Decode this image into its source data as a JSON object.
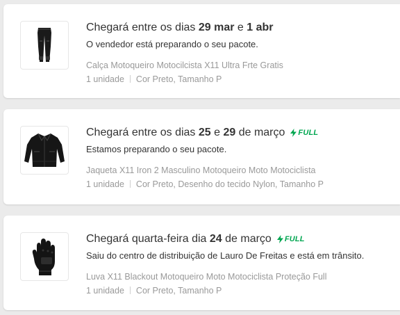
{
  "accent_color": "#00a650",
  "orders": [
    {
      "headline": {
        "prefix": "Chegará entre os dias ",
        "d1": "29 mar",
        "mid": " e ",
        "d2": "1 abr",
        "suffix": ""
      },
      "full_badge": "",
      "status": "O vendedor está preparando o seu pacote.",
      "product_title": "Calça Motoqueiro Motocilcista X11 Ultra Frte Gratis",
      "quantity": "1 unidade",
      "variant": "Cor Preto, Tamanho P",
      "thumbnail_icon": "pants-icon"
    },
    {
      "headline": {
        "prefix": "Chegará entre os dias ",
        "d1": "25",
        "mid": " e ",
        "d2": "29",
        "suffix": " de março"
      },
      "full_badge": "FULL",
      "status": "Estamos preparando o seu pacote.",
      "product_title": "Jaqueta X11 Iron 2 Masculino Motoqueiro Moto Motociclista",
      "quantity": "1 unidade",
      "variant": "Cor Preto, Desenho do tecido Nylon, Tamanho P",
      "thumbnail_icon": "jacket-icon"
    },
    {
      "headline": {
        "prefix": "Chegará quarta-feira dia ",
        "d1": "24",
        "mid": "",
        "d2": "",
        "suffix": " de março"
      },
      "full_badge": "FULL",
      "status": "Saiu do centro de distribuição de Lauro De Freitas e está em trânsito.",
      "product_title": "Luva X11 Blackout Motoqueiro Moto Motociclista Proteção Full",
      "quantity": "1 unidade",
      "variant": "Cor Preto, Tamanho P",
      "thumbnail_icon": "glove-icon"
    }
  ]
}
